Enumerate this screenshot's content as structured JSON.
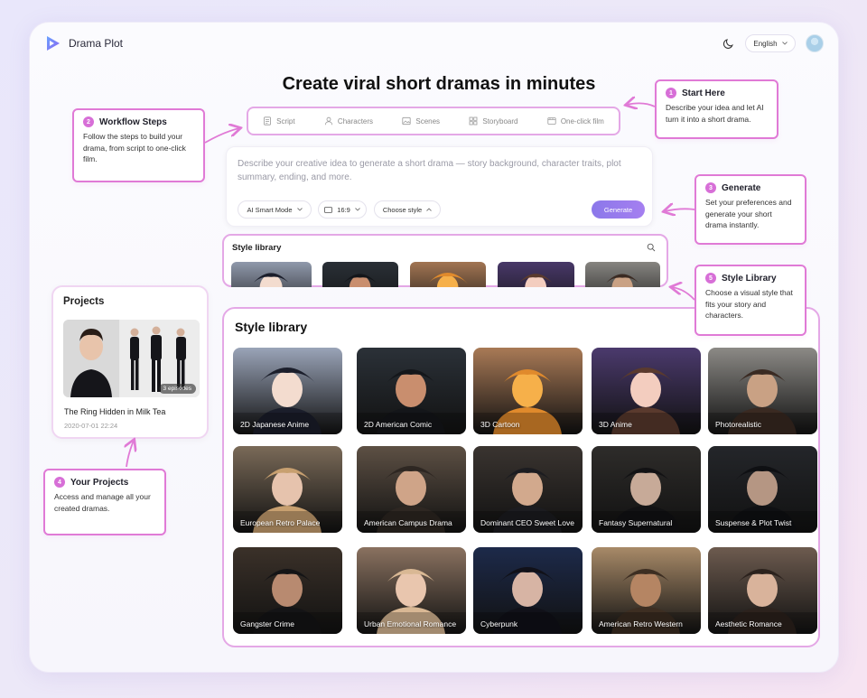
{
  "app": {
    "brand": "Drama Plot",
    "language": "English"
  },
  "hero": {
    "title": "Create viral short dramas in minutes"
  },
  "workflow": {
    "steps": [
      {
        "label": "Script",
        "icon": "document-icon"
      },
      {
        "label": "Characters",
        "icon": "person-icon"
      },
      {
        "label": "Scenes",
        "icon": "image-icon"
      },
      {
        "label": "Storyboard",
        "icon": "grid-icon"
      },
      {
        "label": "One-click film",
        "icon": "film-icon"
      }
    ]
  },
  "prompt": {
    "placeholder": "Describe your creative idea to generate a short drama — story background, character traits, plot summary, ending, and more.",
    "mode": "AI Smart Mode",
    "ratio": "16:9",
    "style": "Choose style",
    "generate": "Generate"
  },
  "mini_library": {
    "title": "Style library"
  },
  "projects": {
    "title": "Projects",
    "item": {
      "name": "The Ring Hidden in Milk Tea",
      "date": "2020-07-01 22:24",
      "episodes": "3 episodes"
    }
  },
  "library": {
    "title": "Style library",
    "styles": [
      {
        "label": "2D Japanese Anime",
        "bg": "#9aa4b8",
        "fg": "#1b1e2b",
        "skin": "#f3dccf"
      },
      {
        "label": "2D American Comic",
        "bg": "#2b3138",
        "fg": "#14161a",
        "skin": "#c98e6e"
      },
      {
        "label": "3D Cartoon",
        "bg": "#a97a56",
        "fg": "#e08a2c",
        "skin": "#f6b04a"
      },
      {
        "label": "3D Anime",
        "bg": "#4b3a6d",
        "fg": "#5a3a2e",
        "skin": "#f3cdbf"
      },
      {
        "label": "Photorealistic",
        "bg": "#8c8a86",
        "fg": "#3a2a22",
        "skin": "#c9a184"
      },
      {
        "label": "European Retro Palace",
        "bg": "#7a6a58",
        "fg": "#c8a070",
        "skin": "#e6c3ad"
      },
      {
        "label": "American Campus Drama",
        "bg": "#5d5044",
        "fg": "#2e2722",
        "skin": "#cfa488"
      },
      {
        "label": "Dominant CEO Sweet Love",
        "bg": "#3a3430",
        "fg": "#1c1c20",
        "skin": "#d2a98d"
      },
      {
        "label": "Fantasy Supernatural",
        "bg": "#2e2c2a",
        "fg": "#121214",
        "skin": "#c7aa98"
      },
      {
        "label": "Suspense & Plot Twist",
        "bg": "#24262a",
        "fg": "#0f1013",
        "skin": "#b59683"
      },
      {
        "label": "Gangster Crime",
        "bg": "#3b3129",
        "fg": "#141416",
        "skin": "#b88a70"
      },
      {
        "label": "Urban Emotional Romance",
        "bg": "#8a7260",
        "fg": "#d9b894",
        "skin": "#e9c6ae"
      },
      {
        "label": "Cyberpunk",
        "bg": "#1d2a4a",
        "fg": "#111119",
        "skin": "#d7b4a4"
      },
      {
        "label": "American Retro Western",
        "bg": "#a88a68",
        "fg": "#3d2e22",
        "skin": "#b58563"
      },
      {
        "label": "Aesthetic Romance",
        "bg": "#6d5b4f",
        "fg": "#2c221d",
        "skin": "#d9b39b"
      }
    ]
  },
  "annotations": [
    {
      "num": "1",
      "title": "Start Here",
      "body": "Describe your idea and let AI turn it into a short drama."
    },
    {
      "num": "2",
      "title": "Workflow Steps",
      "body": "Follow the steps to build your drama, from script to one-click film."
    },
    {
      "num": "3",
      "title": "Generate",
      "body": "Set your preferences and generate your short drama instantly."
    },
    {
      "num": "4",
      "title": "Your Projects",
      "body": "Access and manage all your created dramas."
    },
    {
      "num": "5",
      "title": "Style Library",
      "body": "Choose a visual style that fits your story and characters."
    }
  ],
  "colors": {
    "accent": "#a57ff0",
    "highlight": "#e07ad6"
  }
}
